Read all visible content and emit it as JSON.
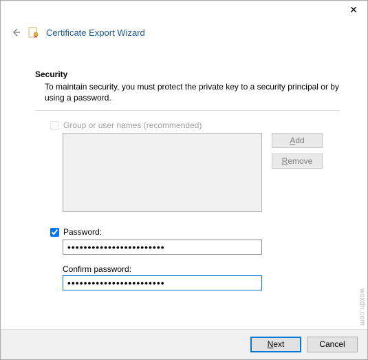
{
  "window": {
    "close_glyph": "✕"
  },
  "header": {
    "back_arrow_glyph": "🡠",
    "title": "Certificate Export Wizard"
  },
  "security": {
    "heading": "Security",
    "description": "To maintain security, you must protect the private key to a security principal or by using a password."
  },
  "group_users": {
    "checkbox_label": "Group or user names (recommended)",
    "checked": false,
    "add_prefix": "A",
    "add_rest": "dd",
    "remove_prefix": "R",
    "remove_rest": "emove"
  },
  "password": {
    "checkbox_label": "Password:",
    "checked": true,
    "value": "••••••••••••••••••••••••",
    "confirm_label": "Confirm password:",
    "confirm_value": "••••••••••••••••••••••••"
  },
  "footer": {
    "next_prefix": "N",
    "next_rest": "ext",
    "cancel": "Cancel"
  },
  "watermark": "wsxdn.com"
}
